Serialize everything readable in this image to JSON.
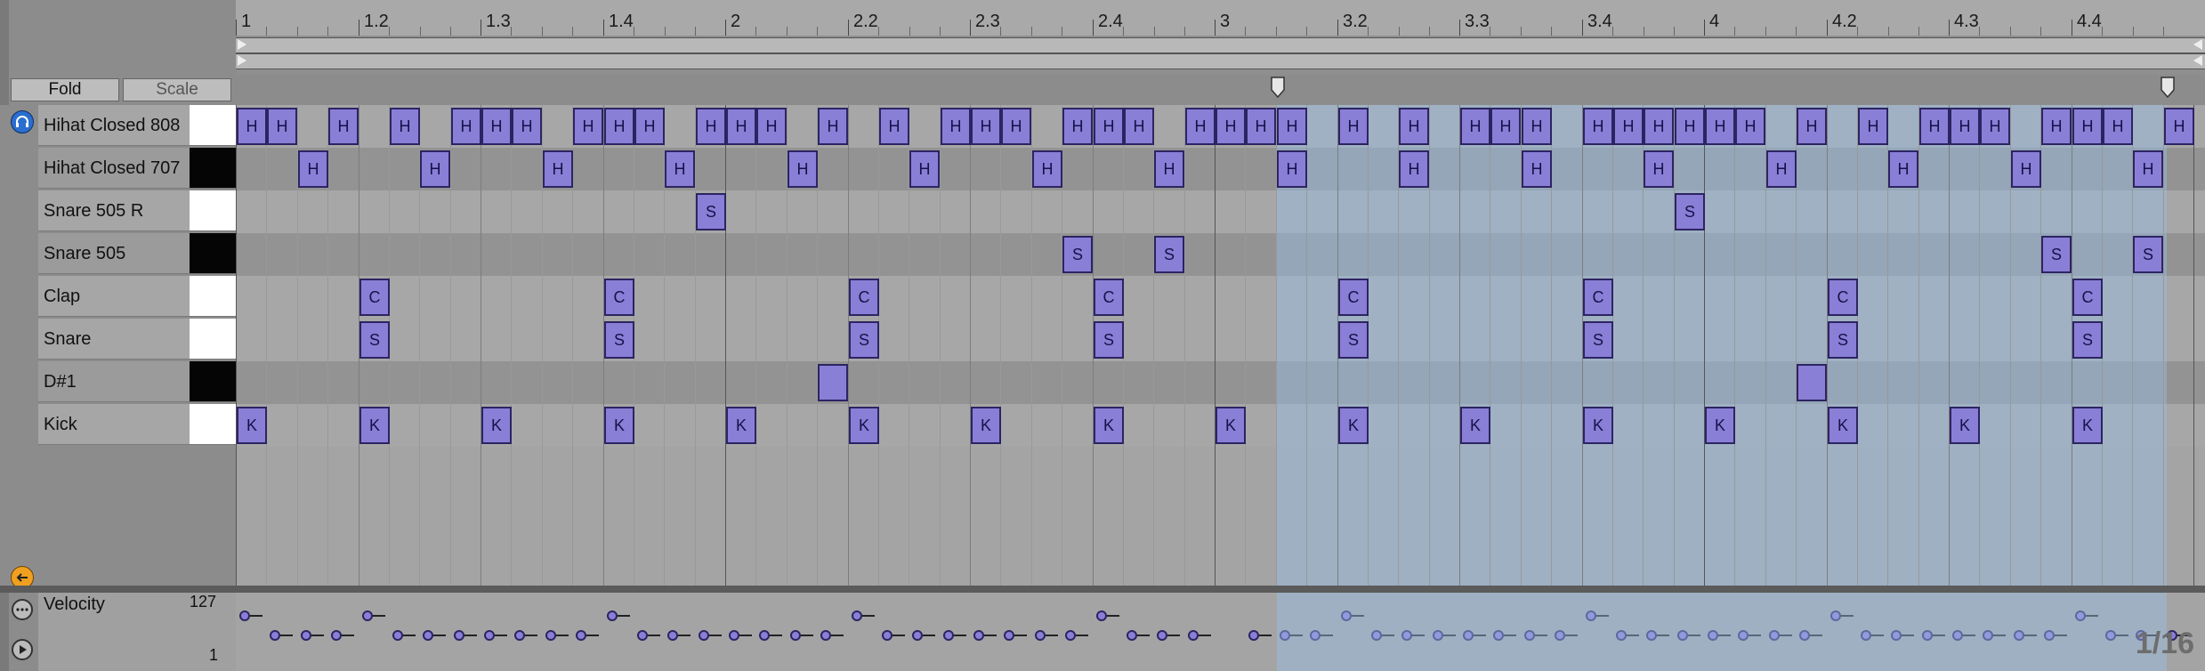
{
  "ruler": {
    "bars": [
      "1",
      "1.2",
      "1.3",
      "1.4",
      "2",
      "2.2",
      "2.3",
      "2.4",
      "3",
      "3.2",
      "3.3",
      "3.4",
      "4",
      "4.2",
      "4.3",
      "4.4"
    ]
  },
  "header": {
    "fold_label": "Fold",
    "scale_label": "Scale"
  },
  "tracks": [
    {
      "name": "Hihat Closed 808",
      "key": "white",
      "letter": "H",
      "steps": [
        0,
        1,
        3,
        5,
        7,
        8,
        9,
        11,
        12,
        13,
        15,
        16,
        17,
        19,
        21,
        23,
        24,
        25,
        27,
        28,
        29,
        31,
        32,
        33,
        34,
        36,
        38,
        40,
        41,
        42,
        44,
        45,
        46,
        47,
        48,
        49,
        51,
        53,
        55,
        56,
        57,
        59,
        60,
        61,
        63
      ]
    },
    {
      "name": "Hihat Closed 707",
      "key": "black",
      "letter": "H",
      "steps": [
        2,
        6,
        10,
        14,
        18,
        22,
        26,
        30,
        34,
        38,
        42,
        46,
        50,
        54,
        58,
        62
      ]
    },
    {
      "name": "Snare 505 R",
      "key": "white",
      "letter": "S",
      "steps": [
        15,
        47
      ]
    },
    {
      "name": "Snare 505",
      "key": "black",
      "letter": "S",
      "steps": [
        27,
        30,
        59,
        62
      ]
    },
    {
      "name": "Clap",
      "key": "white",
      "letter": "C",
      "steps": [
        4,
        12,
        20,
        28,
        36,
        44,
        52,
        60
      ]
    },
    {
      "name": "Snare",
      "key": "white",
      "letter": "S",
      "steps": [
        4,
        12,
        20,
        28,
        36,
        44,
        52,
        60
      ]
    },
    {
      "name": "D#1",
      "key": "black",
      "letter": "",
      "steps": [
        19,
        51
      ]
    },
    {
      "name": "Kick",
      "key": "white",
      "letter": "K",
      "steps": [
        0,
        4,
        8,
        12,
        16,
        20,
        24,
        28,
        32,
        36,
        40,
        44,
        48,
        52,
        56,
        60
      ]
    }
  ],
  "velocity": {
    "label": "Velocity",
    "max": "127",
    "min": "1"
  },
  "grid_resolution": "1/16",
  "colors": {
    "note_fill": "#8a7fd6",
    "note_border": "#2c2462",
    "loop_tint": "#96bee6",
    "accent_blue": "#2a6fcf",
    "accent_orange": "#f0a020"
  },
  "icons": [
    "headphones-icon",
    "back-arrow-icon",
    "options-icon",
    "play-icon",
    "loop-start-marker-icon",
    "loop-end-marker-icon"
  ]
}
